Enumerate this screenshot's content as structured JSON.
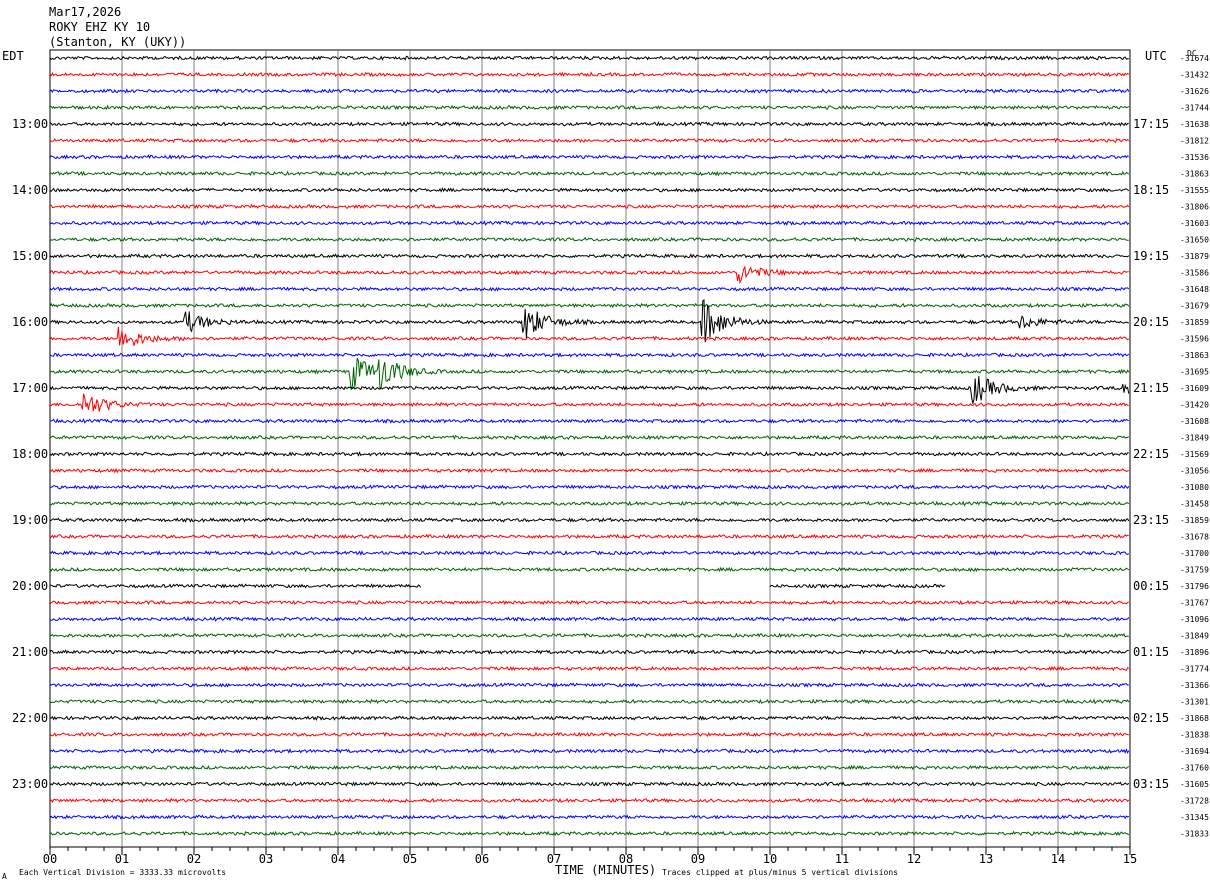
{
  "header": {
    "date": "Mar17,2026",
    "station": "ROKY EHZ KY 10",
    "location": "(Stanton, KY (UKY))"
  },
  "left_tz": "EDT",
  "right_tz": "UTC",
  "dc_label": "DC",
  "footer": {
    "xlabel": "TIME (MINUTES)",
    "scale_note": "Each Vertical Division = 3333.33 microvolts",
    "clip_note": "Traces clipped at plus/minus 5 vertical divisions",
    "corner_mark": "A"
  },
  "chart_data": {
    "type": "line",
    "xlabel": "TIME (MINUTES)",
    "xlim": [
      0,
      15
    ],
    "x_ticks": [
      "00",
      "01",
      "02",
      "03",
      "04",
      "05",
      "06",
      "07",
      "08",
      "09",
      "10",
      "11",
      "12",
      "13",
      "14",
      "15"
    ],
    "trace_colors": [
      "#000000",
      "#ff0000",
      "#0000ff",
      "#006400"
    ],
    "left_hour_labels": [
      "13:00",
      "14:00",
      "15:00",
      "16:00",
      "17:00",
      "18:00",
      "19:00",
      "20:00",
      "21:00",
      "22:00",
      "23:00"
    ],
    "right_hour_labels": [
      "17:15",
      "18:15",
      "19:15",
      "20:15",
      "21:15",
      "22:15",
      "23:15",
      "00:15",
      "01:15",
      "02:15",
      "03:15"
    ],
    "dc_offsets": [
      "-31674",
      "-31432",
      "-31626",
      "-31744",
      "-31638",
      "-31812",
      "-31536",
      "-31863",
      "-31555",
      "-31806",
      "-31603",
      "-31650",
      "-31879",
      "-31586",
      "-31648",
      "-31679",
      "-31859",
      "-31596",
      "-31863",
      "-31695",
      "-31609",
      "-31420",
      "-31608",
      "-31849",
      "-31569",
      "-31056",
      "-31080",
      "-31458",
      "-31859",
      "-31678",
      "-31700",
      "-31759",
      "-31796",
      "-31767",
      "-31096",
      "-31849",
      "-31896",
      "-31774",
      "-31366",
      "-31301",
      "-31868",
      "-31838",
      "-31694",
      "-31760",
      "-31605",
      "-31728",
      "-31345",
      "-31833"
    ],
    "num_traces": 48,
    "gap_trace": 32,
    "gap_segments": [
      [
        0,
        5.15
      ],
      [
        10.0,
        12.45
      ]
    ],
    "events": [
      {
        "trace": 16,
        "minute": 1.9,
        "amp": 3.5
      },
      {
        "trace": 16,
        "minute": 6.6,
        "amp": 6
      },
      {
        "trace": 16,
        "minute": 9.1,
        "amp": 7
      },
      {
        "trace": 16,
        "minute": 13.5,
        "amp": 2
      },
      {
        "trace": 17,
        "minute": 1.0,
        "amp": 4
      },
      {
        "trace": 19,
        "minute": 4.2,
        "amp": 6
      },
      {
        "trace": 19,
        "minute": 4.6,
        "amp": 5
      },
      {
        "trace": 20,
        "minute": 12.85,
        "amp": 5
      },
      {
        "trace": 20,
        "minute": 14.95,
        "amp": 3
      },
      {
        "trace": 21,
        "minute": 0.5,
        "amp": 4
      },
      {
        "trace": 13,
        "minute": 9.6,
        "amp": 3
      }
    ]
  }
}
